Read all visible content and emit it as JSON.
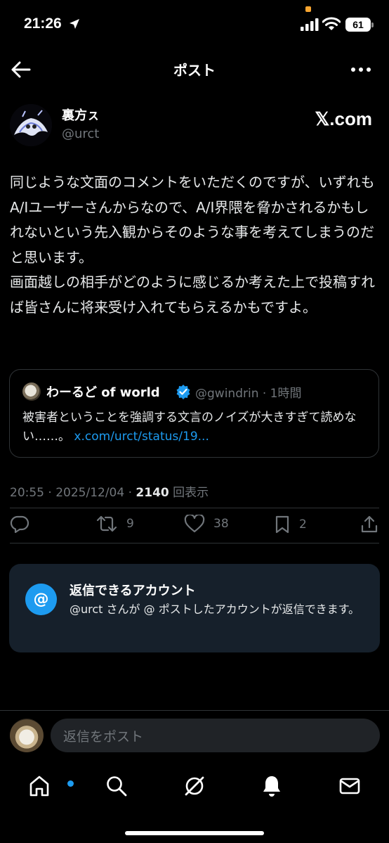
{
  "status_bar": {
    "time": "21:26",
    "battery": "61"
  },
  "header": {
    "title": "ポスト"
  },
  "post": {
    "display_name": "裏方ㇲ",
    "handle": "@urct",
    "source_logo": "𝕏.com",
    "text": "同じような文面のコメントをいただくのですが、いずれもA/Iユーザーさんからなので、A/I界隈を脅かされるかもしれないという先入観からそのような事を考えてしまうのだと思います。\n画面越しの相手がどのように感じるか考えた上で投稿すれば皆さんに将来受け入れてもらえるかもですよ。"
  },
  "quote": {
    "name": "わーるど of world",
    "handle_time": "@gwindrin · 1時間",
    "text": "被害者ということを強調する文言のノイズが大きすぎて読めない……。",
    "link": "x.com/urct/status/19..."
  },
  "meta": {
    "datetime": "20:55 · 2025/12/04 · ",
    "views": "2140",
    "views_label": " 回表示"
  },
  "actions": {
    "retweets": "9",
    "likes": "38",
    "bookmarks": "2"
  },
  "reply_permission": {
    "icon": "@",
    "title": "返信できるアカウント",
    "body": "@urct さんが @ ポストしたアカウントが返信できます。"
  },
  "reply_bar": {
    "placeholder": "返信をポスト"
  },
  "colors": {
    "accent": "#1d9bf0",
    "muted": "#71767b",
    "background": "#000000",
    "card": "#16202b"
  }
}
